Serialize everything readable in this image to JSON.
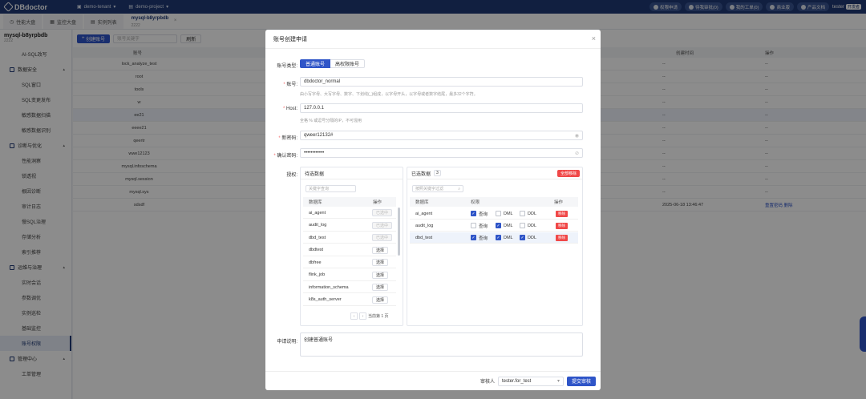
{
  "topbar": {
    "logo": "DBdoctor",
    "tenant": "demo-tenant",
    "project": "demo-project",
    "pills": [
      "权限申请",
      "待我审批(0)",
      "我的工单(0)",
      "商业版",
      "产品文档"
    ],
    "user": "tester",
    "user_badge": "开发者"
  },
  "tabs": [
    {
      "label": "性能大盘"
    },
    {
      "label": "监控大盘"
    },
    {
      "label": "实例列表"
    },
    {
      "label": "mysql-b8yrpbdb",
      "sub": "2222"
    }
  ],
  "sidebar": {
    "title": "mysql-b8yrpbdb",
    "subtitle": "2222",
    "items": [
      {
        "type": "item",
        "label": "AI-SQL改写"
      },
      {
        "type": "group",
        "label": "数据安全"
      },
      {
        "type": "item",
        "label": "SQL窗口"
      },
      {
        "type": "item",
        "label": "SQL变更发布"
      },
      {
        "type": "item",
        "label": "敏感数据扫描"
      },
      {
        "type": "item",
        "label": "敏感数据识别"
      },
      {
        "type": "group",
        "label": "诊断与优化"
      },
      {
        "type": "item",
        "label": "性能洞察"
      },
      {
        "type": "item",
        "label": "锁透视"
      },
      {
        "type": "item",
        "label": "根因诊断"
      },
      {
        "type": "item",
        "label": "审计日志"
      },
      {
        "type": "item",
        "label": "慢SQL治理"
      },
      {
        "type": "item",
        "label": "存储分析"
      },
      {
        "type": "item",
        "label": "索引推荐"
      },
      {
        "type": "group",
        "label": "运维与治理"
      },
      {
        "type": "item",
        "label": "实时会话"
      },
      {
        "type": "item",
        "label": "参数调优"
      },
      {
        "type": "item",
        "label": "实例巡检"
      },
      {
        "type": "item",
        "label": "基础监控"
      },
      {
        "type": "item",
        "label": "账号权限",
        "active": true
      },
      {
        "type": "group",
        "label": "管理中心"
      },
      {
        "type": "item",
        "label": "工单管理"
      }
    ]
  },
  "toolbar": {
    "create_label": "创建账号",
    "search_placeholder": "账号关键字",
    "refresh_label": "刷新"
  },
  "table": {
    "columns": [
      "账号",
      "创建时间",
      "操作"
    ],
    "rows": [
      {
        "account": "lock_analyze_test",
        "created": "--",
        "ops": "--"
      },
      {
        "account": "root",
        "created": "--",
        "ops": "--"
      },
      {
        "account": "tools",
        "created": "--",
        "ops": "--"
      },
      {
        "account": "w",
        "created": "--",
        "ops": "--"
      },
      {
        "account": "ee21",
        "created": "--",
        "ops": "--"
      },
      {
        "account": "eeee21",
        "created": "--",
        "ops": "--"
      },
      {
        "account": "qeertr",
        "created": "--",
        "ops": "--"
      },
      {
        "account": "wwe12123",
        "created": "--",
        "ops": "--"
      },
      {
        "account": "mysql.infoschema",
        "created": "--",
        "ops": "--"
      },
      {
        "account": "mysql.session",
        "created": "--",
        "ops": "--"
      },
      {
        "account": "mysql.sys",
        "created": "--",
        "ops": "--"
      },
      {
        "account": "sdsdf",
        "created": "2025-06-18 13:46:47",
        "ops": "重置密码  删除"
      }
    ]
  },
  "modal": {
    "title": "账号创建申请",
    "type_label": "账号类型:",
    "type_normal": "普通账号",
    "type_admin": "高权限账号",
    "account_label": "账号:",
    "account_value": "dbdoctor_normal",
    "account_hint": "由小写字母、大写字母、数字、下划线(_)组成，以字母开头，以字母或者数字结尾，最多32个字符。",
    "host_label": "Host:",
    "host_value": "127.0.0.1",
    "host_hint": "全格 % 或逗号分隔的IP，不可混用",
    "pwd_label": "新密码:",
    "pwd_value": "qweer12132#",
    "confirm_label": "确认密码:",
    "confirm_value": "••••••••••••",
    "auth_label": "授权:",
    "left_panel": {
      "title": "待选数据",
      "search_placeholder": "关键字查询",
      "col_db": "数据库",
      "col_op": "操作",
      "rows": [
        {
          "db": "ai_agent",
          "op": "已选中",
          "disabled": true
        },
        {
          "db": "audit_log",
          "op": "已选中",
          "disabled": true
        },
        {
          "db": "dbd_test",
          "op": "已选中",
          "disabled": true
        },
        {
          "db": "dbdtest",
          "op": "选择",
          "disabled": false
        },
        {
          "db": "dbfree",
          "op": "选择",
          "disabled": false
        },
        {
          "db": "flink_job",
          "op": "选择",
          "disabled": false
        },
        {
          "db": "information_schema",
          "op": "选择",
          "disabled": false
        },
        {
          "db": "k8s_auth_server",
          "op": "选择",
          "disabled": false
        }
      ],
      "pager": "当前第 1 页"
    },
    "right_panel": {
      "title": "已选数据",
      "count": "3",
      "remove_all": "全部移除",
      "search_placeholder": "按照关键字过滤",
      "col_db": "数据库",
      "col_perm": "权限",
      "col_op": "操作",
      "perm_labels": [
        "查询",
        "DML",
        "DDL"
      ],
      "remove_label": "移除",
      "rows": [
        {
          "db": "ai_agent",
          "perms": [
            true,
            false,
            false
          ]
        },
        {
          "db": "audit_log",
          "perms": [
            false,
            true,
            false
          ]
        },
        {
          "db": "dbd_test",
          "perms": [
            true,
            true,
            true
          ]
        }
      ]
    },
    "note_label": "申请说明:",
    "note_value": "创建普通账号",
    "reviewer_label": "审核人",
    "reviewer_value": "tester.for_test",
    "submit_label": "提交审核"
  }
}
